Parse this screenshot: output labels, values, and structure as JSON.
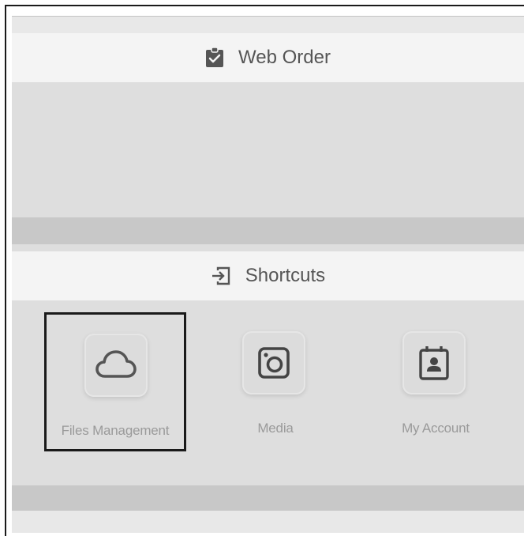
{
  "sections": {
    "web_order": {
      "title": "Web Order",
      "icon": "clipboard-check-icon"
    },
    "shortcuts": {
      "title": "Shortcuts",
      "icon": "login-arrow-icon",
      "items": [
        {
          "label": "Files Management",
          "icon": "cloud-icon"
        },
        {
          "label": "Media",
          "icon": "camera-icon"
        },
        {
          "label": "My Account",
          "icon": "contact-calendar-icon"
        }
      ]
    }
  },
  "colors": {
    "header_bg": "#f4f4f4",
    "panel_bg": "#dedede",
    "separator": "#c8c8c8",
    "text": "#555555",
    "label": "#9a9a9a"
  }
}
